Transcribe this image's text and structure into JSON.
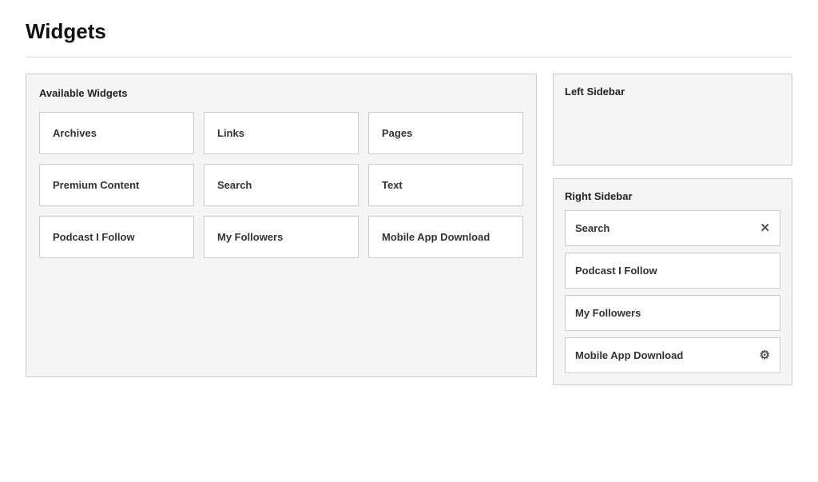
{
  "page": {
    "title": "Widgets"
  },
  "available_widgets": {
    "panel_title": "Available Widgets",
    "items": [
      {
        "id": "archives",
        "label": "Archives"
      },
      {
        "id": "links",
        "label": "Links"
      },
      {
        "id": "pages",
        "label": "Pages"
      },
      {
        "id": "premium-content",
        "label": "Premium Content"
      },
      {
        "id": "search",
        "label": "Search"
      },
      {
        "id": "text",
        "label": "Text"
      },
      {
        "id": "podcast-i-follow",
        "label": "Podcast I Follow"
      },
      {
        "id": "my-followers",
        "label": "My Followers"
      },
      {
        "id": "mobile-app-download",
        "label": "Mobile App Download"
      }
    ]
  },
  "left_sidebar": {
    "title": "Left Sidebar",
    "widgets": []
  },
  "right_sidebar": {
    "title": "Right Sidebar",
    "widgets": [
      {
        "id": "search",
        "label": "Search",
        "action": "close",
        "action_icon": "✕"
      },
      {
        "id": "podcast-i-follow",
        "label": "Podcast I Follow",
        "action": null
      },
      {
        "id": "my-followers",
        "label": "My Followers",
        "action": null
      },
      {
        "id": "mobile-app-download",
        "label": "Mobile App Download",
        "action": "settings",
        "action_icon": "⚙"
      }
    ]
  }
}
